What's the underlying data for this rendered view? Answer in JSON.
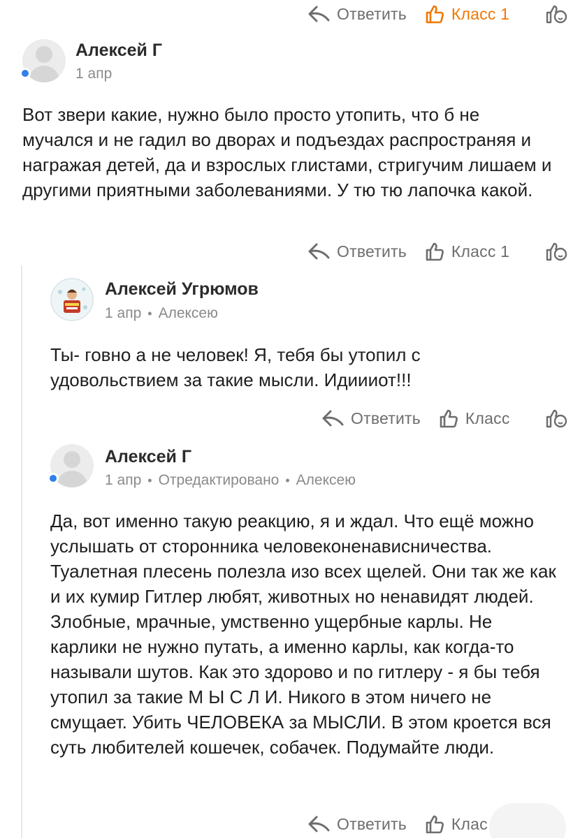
{
  "labels": {
    "reply": "Ответить",
    "klass": "Класс"
  },
  "colors": {
    "accent": "#f07800",
    "online": "#2f80ed",
    "muted": "#8a8a8a"
  },
  "top_actions": {
    "reply": "Ответить",
    "klass": "Класс 1",
    "klass_active": true
  },
  "comments": [
    {
      "author": "Алексей Г",
      "date": "1 апр",
      "online": true,
      "text": "Вот звери какие, нужно было просто утопить, что б не мучался и не гадил во дворах и подъездах распространяя и награжая детей, да и взрослых глистами, стригучим лишаем и другими приятными заболеваниями. У тю тю лапочка какой.",
      "reply_label": "Ответить",
      "klass_label": "Класс 1"
    },
    {
      "author": "Алексей Угрюмов",
      "date": "1 апр",
      "reply_to": "Алексею",
      "text": "Ты- говно а не человек! Я, тебя бы утопил с удовольствием за такие мысли. Идиииот!!!",
      "reply_label": "Ответить",
      "klass_label": "Класс"
    },
    {
      "author": "Алексей Г",
      "date": "1 апр",
      "edited": "Отредактировано",
      "reply_to": "Алексею",
      "online": true,
      "text": "Да, вот именно такую реакцию, я и ждал. Что ещё можно услышать от сторонника человеконенависничества. Туалетная плесень полезла изо всех щелей. Они так же как и их кумир Гитлер любят, животных но ненавидят людей. Злобные, мрачные, умственно ущербные карлы. Не карлики не нужно путать, а именно карлы, как когда-то называли шутов. Как это здорово и по гитлеру - я бы тебя утопил за такие М Ы С Л И. Никого в этом ничего не смущает. Убить ЧЕЛОВЕКА за МЫСЛИ. В этом кроется вся суть любителей кошечек, собачек. Подумайте люди.",
      "reply_label": "Ответить",
      "klass_label": "Клас"
    }
  ],
  "icons": [
    "reply-icon",
    "thumb-up-icon",
    "emoji-reaction-icon",
    "avatar-placeholder-icon"
  ]
}
